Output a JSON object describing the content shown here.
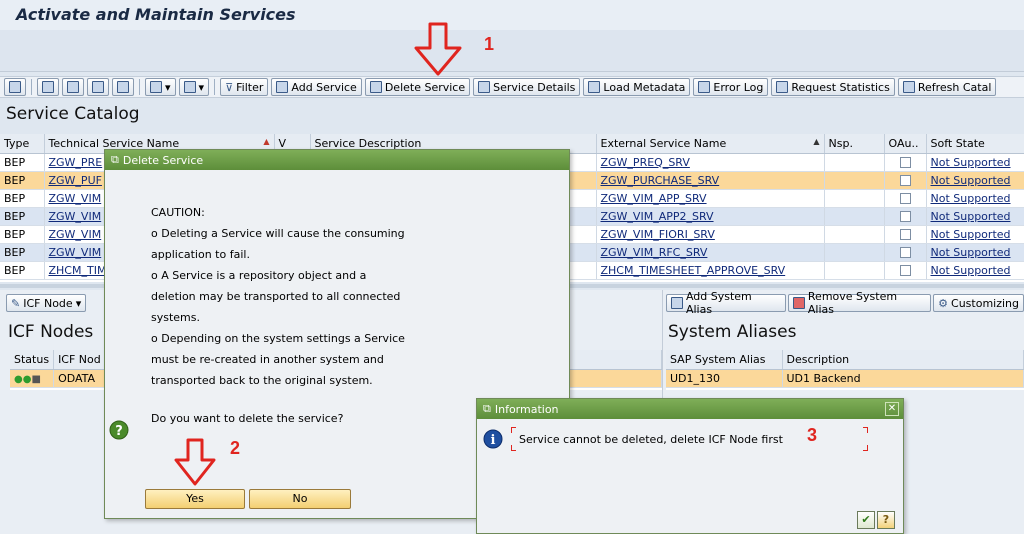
{
  "app_title": "Activate and Maintain Services",
  "toolbar": {
    "filter": "Filter",
    "add_service": "Add Service",
    "delete_service": "Delete Service",
    "service_details": "Service Details",
    "load_metadata": "Load Metadata",
    "error_log": "Error Log",
    "request_statistics": "Request Statistics",
    "refresh_catalog": "Refresh Catal"
  },
  "catalog": {
    "title": "Service Catalog",
    "columns": [
      "Type",
      "Technical Service Name",
      "V",
      "Service Description",
      "External Service Name",
      "Nsp.",
      "OAu..",
      "Soft State"
    ],
    "rows": [
      {
        "type": "BEP",
        "tech": "ZGW_PRE",
        "ext": "ZGW_PREQ_SRV",
        "soft": "Not Supported",
        "style": "white"
      },
      {
        "type": "BEP",
        "tech": "ZGW_PUF",
        "ext": "ZGW_PURCHASE_SRV",
        "soft": "Not Supported",
        "style": "orange"
      },
      {
        "type": "BEP",
        "tech": "ZGW_VIM",
        "ext": "ZGW_VIM_APP_SRV",
        "soft": "Not Supported",
        "style": "white"
      },
      {
        "type": "BEP",
        "tech": "ZGW_VIM",
        "ext": "ZGW_VIM_APP2_SRV",
        "soft": "Not Supported",
        "style": "blue"
      },
      {
        "type": "BEP",
        "tech": "ZGW_VIM",
        "ext": "ZGW_VIM_FIORI_SRV",
        "soft": "Not Supported",
        "style": "white"
      },
      {
        "type": "BEP",
        "tech": "ZGW_VIM",
        "ext": "ZGW_VIM_RFC_SRV",
        "soft": "Not Supported",
        "style": "blue"
      },
      {
        "type": "BEP",
        "tech": "ZHCM_TIM",
        "ext": "ZHCM_TIMESHEET_APPROVE_SRV",
        "soft": "Not Supported",
        "style": "white"
      }
    ]
  },
  "icf": {
    "button": "ICF Node",
    "title": "ICF Nodes",
    "columns": [
      "Status",
      "ICF Nod"
    ],
    "rows": [
      {
        "name": "ODATA"
      }
    ]
  },
  "aliases": {
    "add_button": "Add System Alias",
    "remove_button": "Remove System Alias",
    "customizing_button": "Customizing",
    "title": "System Aliases",
    "columns": [
      "SAP System Alias",
      "Description"
    ],
    "rows": [
      {
        "alias": "UD1_130",
        "description": "UD1 Backend"
      }
    ]
  },
  "delete_dialog": {
    "title": "Delete Service",
    "caution": "CAUTION:",
    "lines": [
      "o Deleting a Service will cause the consuming",
      "application to fail.",
      "o A Service is a repository object and a",
      "deletion may be transported to all connected",
      "systems.",
      "o Depending on the system settings a Service",
      "must be re-created in another system and",
      "transported back to the original system."
    ],
    "question": "Do you want to delete the service?",
    "yes": "Yes",
    "no": "No"
  },
  "info_dialog": {
    "title": "Information",
    "message": "Service cannot be deleted, delete ICF Node first"
  },
  "annotations": {
    "step1": "1",
    "step2": "2",
    "step3": "3"
  },
  "colors": {
    "accent_red": "#e0251f",
    "dialog_green": "#5d8e3a",
    "selected_row": "#fbd89a"
  }
}
